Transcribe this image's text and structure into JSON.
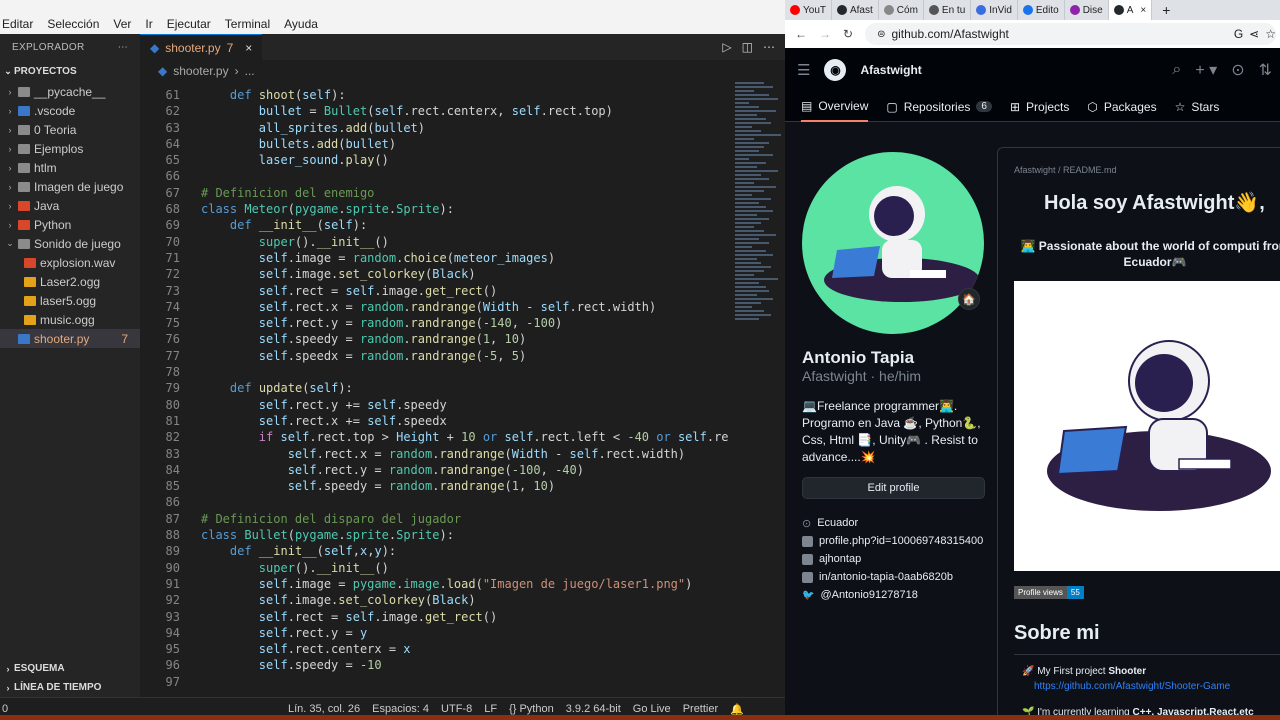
{
  "vscode": {
    "menu": [
      "Editar",
      "Selección",
      "Ver",
      "Ir",
      "Ejecutar",
      "Terminal",
      "Ayuda"
    ],
    "explorer_title": "EXPLORADOR",
    "section": "PROYECTOS",
    "tree": [
      {
        "label": "__pycache__",
        "type": "folder",
        "color": "#8b8b8b",
        "indent": 1
      },
      {
        "label": ".vscode",
        "type": "folder",
        "color": "#3a77c9",
        "indent": 1
      },
      {
        "label": "0 Teoria",
        "type": "folder",
        "color": "#8b8b8b",
        "indent": 1
      },
      {
        "label": "Ejemplos",
        "type": "folder",
        "color": "#8b8b8b",
        "indent": 1
      },
      {
        "label": "htlm",
        "type": "folder",
        "color": "#8b8b8b",
        "indent": 1
      },
      {
        "label": "Imagen de juego",
        "type": "folder",
        "color": "#8b8b8b",
        "indent": 1
      },
      {
        "label": "Java",
        "type": "folder",
        "color": "#d9472b",
        "indent": 1
      },
      {
        "label": "Python",
        "type": "folder",
        "color": "#d9472b",
        "indent": 1
      },
      {
        "label": "Sonido de juego",
        "type": "folder-open",
        "color": "#8b8b8b",
        "indent": 1
      },
      {
        "label": "explosion.wav",
        "type": "file",
        "color": "#d9472b",
        "indent": 2
      },
      {
        "label": "Laser2.ogg",
        "type": "file",
        "color": "#e3a21a",
        "indent": 2
      },
      {
        "label": "laser5.ogg",
        "type": "file",
        "color": "#e3a21a",
        "indent": 2
      },
      {
        "label": "music.ogg",
        "type": "file",
        "color": "#e3a21a",
        "indent": 2
      },
      {
        "label": "shooter.py",
        "type": "file",
        "color": "#3a77c9",
        "indent": 1,
        "active": true,
        "badge": "7"
      }
    ],
    "outline": "ESQUEMA",
    "timeline": "LÍNEA DE TIEMPO",
    "tab": {
      "name": "shooter.py",
      "badge": "7",
      "close": "×"
    },
    "breadcrumb": [
      "shooter.py",
      "..."
    ],
    "status": [
      "Lín. 35, col. 26",
      "Espacios: 4",
      "UTF-8",
      "LF",
      "{} Python",
      "3.9.2 64-bit",
      "Go Live",
      "Prettier"
    ],
    "status_left": "0"
  },
  "code_lines": [
    {
      "n": "61",
      "h": "    <span class=\"k\">def</span> <span class=\"f\">shoot</span>(<span class=\"v\">self</span>):"
    },
    {
      "n": "62",
      "h": "        <span class=\"v\">bullet</span> = <span class=\"cl\">Bullet</span>(<span class=\"v\">self</span>.rect.centerx, <span class=\"v\">self</span>.rect.top)"
    },
    {
      "n": "63",
      "h": "        <span class=\"v\">all_sprites</span>.<span class=\"f\">add</span>(<span class=\"v\">bullet</span>)"
    },
    {
      "n": "64",
      "h": "        <span class=\"v\">bullets</span>.<span class=\"f\">add</span>(<span class=\"v\">bullet</span>)"
    },
    {
      "n": "65",
      "h": "        <span class=\"v\">laser_sound</span>.<span class=\"f\">play</span>()"
    },
    {
      "n": "66",
      "h": ""
    },
    {
      "n": "67",
      "h": "<span class=\"c\"># Definicion del enemigo</span>"
    },
    {
      "n": "68",
      "h": "<span class=\"k\">class</span> <span class=\"cl\">Meteor</span>(<span class=\"cl\">pygame</span>.<span class=\"cl\">sprite</span>.<span class=\"cl\">Sprite</span>):"
    },
    {
      "n": "69",
      "h": "    <span class=\"k\">def</span> <span class=\"f\">__init__</span>(<span class=\"v\">self</span>):"
    },
    {
      "n": "70",
      "h": "        <span class=\"cl\">super</span>().<span class=\"f\">__init__</span>()"
    },
    {
      "n": "71",
      "h": "        <span class=\"v\">self</span>.image = <span class=\"cl\">random</span>.<span class=\"f\">choice</span>(<span class=\"v\">meteor_images</span>)"
    },
    {
      "n": "72",
      "h": "        <span class=\"v\">self</span>.image.<span class=\"f\">set_colorkey</span>(<span class=\"v\">Black</span>)"
    },
    {
      "n": "73",
      "h": "        <span class=\"v\">self</span>.rect = <span class=\"v\">self</span>.image.<span class=\"f\">get_rect</span>()"
    },
    {
      "n": "74",
      "h": "        <span class=\"v\">self</span>.rect.x = <span class=\"cl\">random</span>.<span class=\"f\">randrange</span>(<span class=\"v\">Width</span> - <span class=\"v\">self</span>.rect.width)"
    },
    {
      "n": "75",
      "h": "        <span class=\"v\">self</span>.rect.y = <span class=\"cl\">random</span>.<span class=\"f\">randrange</span>(<span class=\"n\">-140</span>, <span class=\"n\">-100</span>)"
    },
    {
      "n": "76",
      "h": "        <span class=\"v\">self</span>.speedy = <span class=\"cl\">random</span>.<span class=\"f\">randrange</span>(<span class=\"n\">1</span>, <span class=\"n\">10</span>)"
    },
    {
      "n": "77",
      "h": "        <span class=\"v\">self</span>.speedx = <span class=\"cl\">random</span>.<span class=\"f\">randrange</span>(<span class=\"n\">-5</span>, <span class=\"n\">5</span>)"
    },
    {
      "n": "78",
      "h": ""
    },
    {
      "n": "79",
      "h": "    <span class=\"k\">def</span> <span class=\"f\">update</span>(<span class=\"v\">self</span>):"
    },
    {
      "n": "80",
      "h": "        <span class=\"v\">self</span>.rect.y += <span class=\"v\">self</span>.speedy"
    },
    {
      "n": "81",
      "h": "        <span class=\"v\">self</span>.rect.x += <span class=\"v\">self</span>.speedx"
    },
    {
      "n": "82",
      "h": "        <span class=\"p\">if</span> <span class=\"v\">self</span>.rect.top &gt; <span class=\"v\">Height</span> + <span class=\"n\">10</span> <span class=\"k\">or</span> <span class=\"v\">self</span>.rect.left &lt; <span class=\"n\">-40</span> <span class=\"k\">or</span> <span class=\"v\">self</span>.re"
    },
    {
      "n": "83",
      "h": "            <span class=\"v\">self</span>.rect.x = <span class=\"cl\">random</span>.<span class=\"f\">randrange</span>(<span class=\"v\">Width</span> - <span class=\"v\">self</span>.rect.width)"
    },
    {
      "n": "84",
      "h": "            <span class=\"v\">self</span>.rect.y = <span class=\"cl\">random</span>.<span class=\"f\">randrange</span>(<span class=\"n\">-100</span>, <span class=\"n\">-40</span>)"
    },
    {
      "n": "85",
      "h": "            <span class=\"v\">self</span>.speedy = <span class=\"cl\">random</span>.<span class=\"f\">randrange</span>(<span class=\"n\">1</span>, <span class=\"n\">10</span>)"
    },
    {
      "n": "86",
      "h": ""
    },
    {
      "n": "87",
      "h": "<span class=\"c\"># Definicion del disparo del jugador</span>"
    },
    {
      "n": "88",
      "h": "<span class=\"k\">class</span> <span class=\"cl\">Bullet</span>(<span class=\"cl\">pygame</span>.<span class=\"cl\">sprite</span>.<span class=\"cl\">Sprite</span>):"
    },
    {
      "n": "89",
      "h": "    <span class=\"k\">def</span> <span class=\"f\">__init__</span>(<span class=\"v\">self</span>,<span class=\"v\">x</span>,<span class=\"v\">y</span>):"
    },
    {
      "n": "90",
      "h": "        <span class=\"cl\">super</span>().<span class=\"f\">__init__</span>()"
    },
    {
      "n": "91",
      "h": "        <span class=\"v\">self</span>.image = <span class=\"cl\">pygame</span>.<span class=\"cl\">image</span>.<span class=\"f\">load</span>(<span class=\"s\">\"Imagen de juego/laser1.png\"</span>)"
    },
    {
      "n": "92",
      "h": "        <span class=\"v\">self</span>.image.<span class=\"f\">set_colorkey</span>(<span class=\"v\">Black</span>)"
    },
    {
      "n": "93",
      "h": "        <span class=\"v\">self</span>.rect = <span class=\"v\">self</span>.image.<span class=\"f\">get_rect</span>()"
    },
    {
      "n": "94",
      "h": "        <span class=\"v\">self</span>.rect.y = <span class=\"v\">y</span>"
    },
    {
      "n": "95",
      "h": "        <span class=\"v\">self</span>.rect.centerx = <span class=\"v\">x</span>"
    },
    {
      "n": "96",
      "h": "        <span class=\"v\">self</span>.speedy = <span class=\"n\">-10</span>"
    },
    {
      "n": "97",
      "h": ""
    }
  ],
  "browser": {
    "tabs": [
      {
        "label": "YouT",
        "color": "#ff0000"
      },
      {
        "label": "Afast",
        "color": "#24292f"
      },
      {
        "label": "Cóm",
        "color": "#888888"
      },
      {
        "label": "En tu",
        "color": "#555555"
      },
      {
        "label": "InVid",
        "color": "#3b6de0"
      },
      {
        "label": "Edito",
        "color": "#1a73e8"
      },
      {
        "label": "Dise",
        "color": "#8e24aa"
      },
      {
        "label": "A",
        "color": "#24292f",
        "active": true
      }
    ],
    "tab_close": "×",
    "new_tab": "+",
    "url": "github.com/Afastwight"
  },
  "github": {
    "username_header": "Afastwight",
    "nav": [
      {
        "label": "Overview",
        "selected": true
      },
      {
        "label": "Repositories",
        "count": "6"
      },
      {
        "label": "Projects"
      },
      {
        "label": "Packages"
      },
      {
        "label": "Stars"
      }
    ],
    "name": "Antonio Tapia",
    "login": "Afastwight · he/him",
    "bio": "💻Freelance programmer👨‍💻. Programo en Java ☕, Python🐍, Css, Html 📑, Unity🎮 . Resist to advance....💥",
    "edit_profile": "Edit profile",
    "meta": [
      "Ecuador",
      "profile.php?id=100069748315400",
      "ajhontap",
      "in/antonio-tapia-0aab6820b",
      "@Antonio91278718"
    ],
    "readme_path": "Afastwight / README.md",
    "readme_title": "Hola soy Afastwight👋,",
    "readme_sub": "👨‍💻 Passionate about the world of computi from Ecuador🎮",
    "profile_views_label": "Profile views",
    "profile_views": "55",
    "about_title": "Sobre mi",
    "item1_prefix": "🚀 My First project ",
    "item1_bold": "Shooter",
    "item1_link": "https://github.com/Afastwight/Shooter-Game",
    "item2_prefix": "🌱 I'm currently learning ",
    "item2_bold": "C++, Javascript,React,etc"
  }
}
